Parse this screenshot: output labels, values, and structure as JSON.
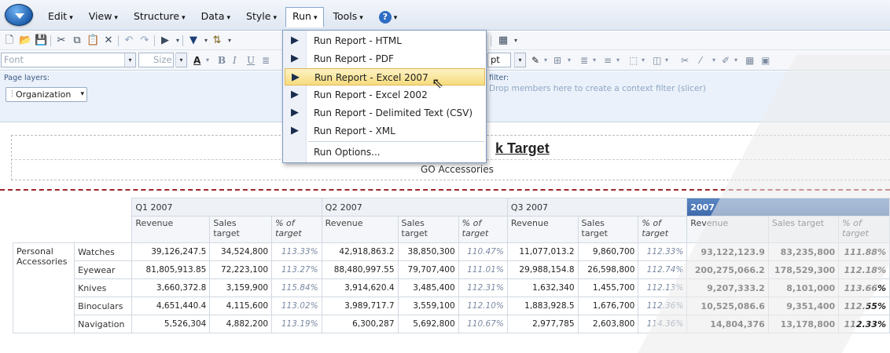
{
  "menubar": {
    "items": [
      {
        "label": "Edit",
        "open": false
      },
      {
        "label": "View",
        "open": false
      },
      {
        "label": "Structure",
        "open": false
      },
      {
        "label": "Data",
        "open": false
      },
      {
        "label": "Style",
        "open": false
      },
      {
        "label": "Run",
        "open": true
      },
      {
        "label": "Tools",
        "open": false
      }
    ],
    "caret": "▾",
    "help_icon": "?"
  },
  "formatbar": {
    "font_placeholder": "Font",
    "size_placeholder": "Size",
    "pt_label": "pt"
  },
  "layers": {
    "page_layers_label": "Page layers:",
    "organization_chip": "Organization",
    "context_filter_label": "filter:",
    "drop_hint": "Drop members here to create a context filter (slicer)"
  },
  "run_menu": {
    "items": [
      {
        "label": "Run Report - HTML",
        "icon": "play-icon"
      },
      {
        "label": "Run Report - PDF",
        "icon": "run-report-icon"
      },
      {
        "label": "Run Report - Excel 2007",
        "icon": "run-report-icon",
        "highlighted": true
      },
      {
        "label": "Run Report - Excel 2002",
        "icon": "run-report-icon"
      },
      {
        "label": "Run Report - Delimited Text (CSV)",
        "icon": "run-report-icon"
      },
      {
        "label": "Run Report - XML",
        "icon": "run-report-icon"
      },
      {
        "label": "Run Options...",
        "icon": ""
      }
    ]
  },
  "report": {
    "title": "k Target",
    "subtitle": "GO Accessories"
  },
  "crosstab": {
    "quarters": [
      "Q1 2007",
      "Q2 2007",
      "Q3 2007"
    ],
    "year": "2007",
    "measure_headers": [
      "Revenue",
      "Sales target",
      "% of target"
    ],
    "sales_target_line1": "Sales",
    "sales_target_line2": "target",
    "pct_line1": "% of",
    "pct_line2": "target",
    "row_group": "Personal Accessories",
    "rows": [
      {
        "product": "Watches",
        "q1": [
          "39,126,247.5",
          "34,524,800",
          "113.33%"
        ],
        "q2": [
          "42,918,863.2",
          "38,850,300",
          "110.47%"
        ],
        "q3": [
          "11,077,013.2",
          "9,860,700",
          "112.33%"
        ],
        "year": [
          "93,122,123.9",
          "83,235,800",
          "111.88%"
        ]
      },
      {
        "product": "Eyewear",
        "q1": [
          "81,805,913.85",
          "72,223,100",
          "113.27%"
        ],
        "q2": [
          "88,480,997.55",
          "79,707,400",
          "111.01%"
        ],
        "q3": [
          "29,988,154.8",
          "26,598,800",
          "112.74%"
        ],
        "year": [
          "200,275,066.2",
          "178,529,300",
          "112.18%"
        ]
      },
      {
        "product": "Knives",
        "q1": [
          "3,660,372.8",
          "3,159,900",
          "115.84%"
        ],
        "q2": [
          "3,914,620.4",
          "3,485,400",
          "112.31%"
        ],
        "q3": [
          "1,632,340",
          "1,455,700",
          "112.13%"
        ],
        "year": [
          "9,207,333.2",
          "8,101,000",
          "113.66%"
        ]
      },
      {
        "product": "Binoculars",
        "q1": [
          "4,651,440.4",
          "4,115,600",
          "113.02%"
        ],
        "q2": [
          "3,989,717.7",
          "3,559,100",
          "112.10%"
        ],
        "q3": [
          "1,883,928.5",
          "1,676,700",
          "112.36%"
        ],
        "year": [
          "10,525,086.6",
          "9,351,400",
          "112.55%"
        ]
      },
      {
        "product": "Navigation",
        "q1": [
          "5,526,304",
          "4,882,200",
          "113.19%"
        ],
        "q2": [
          "6,300,287",
          "5,692,800",
          "110.67%"
        ],
        "q3": [
          "2,977,785",
          "2,603,800",
          "114.36%"
        ],
        "year": [
          "14,804,376",
          "13,178,800",
          "112.33%"
        ]
      }
    ]
  },
  "colors": {
    "menubar": "#dfe7f2",
    "highlight": "#f6dc7e",
    "year_header": "#4a76b6",
    "red_separator": "#a0262a"
  }
}
